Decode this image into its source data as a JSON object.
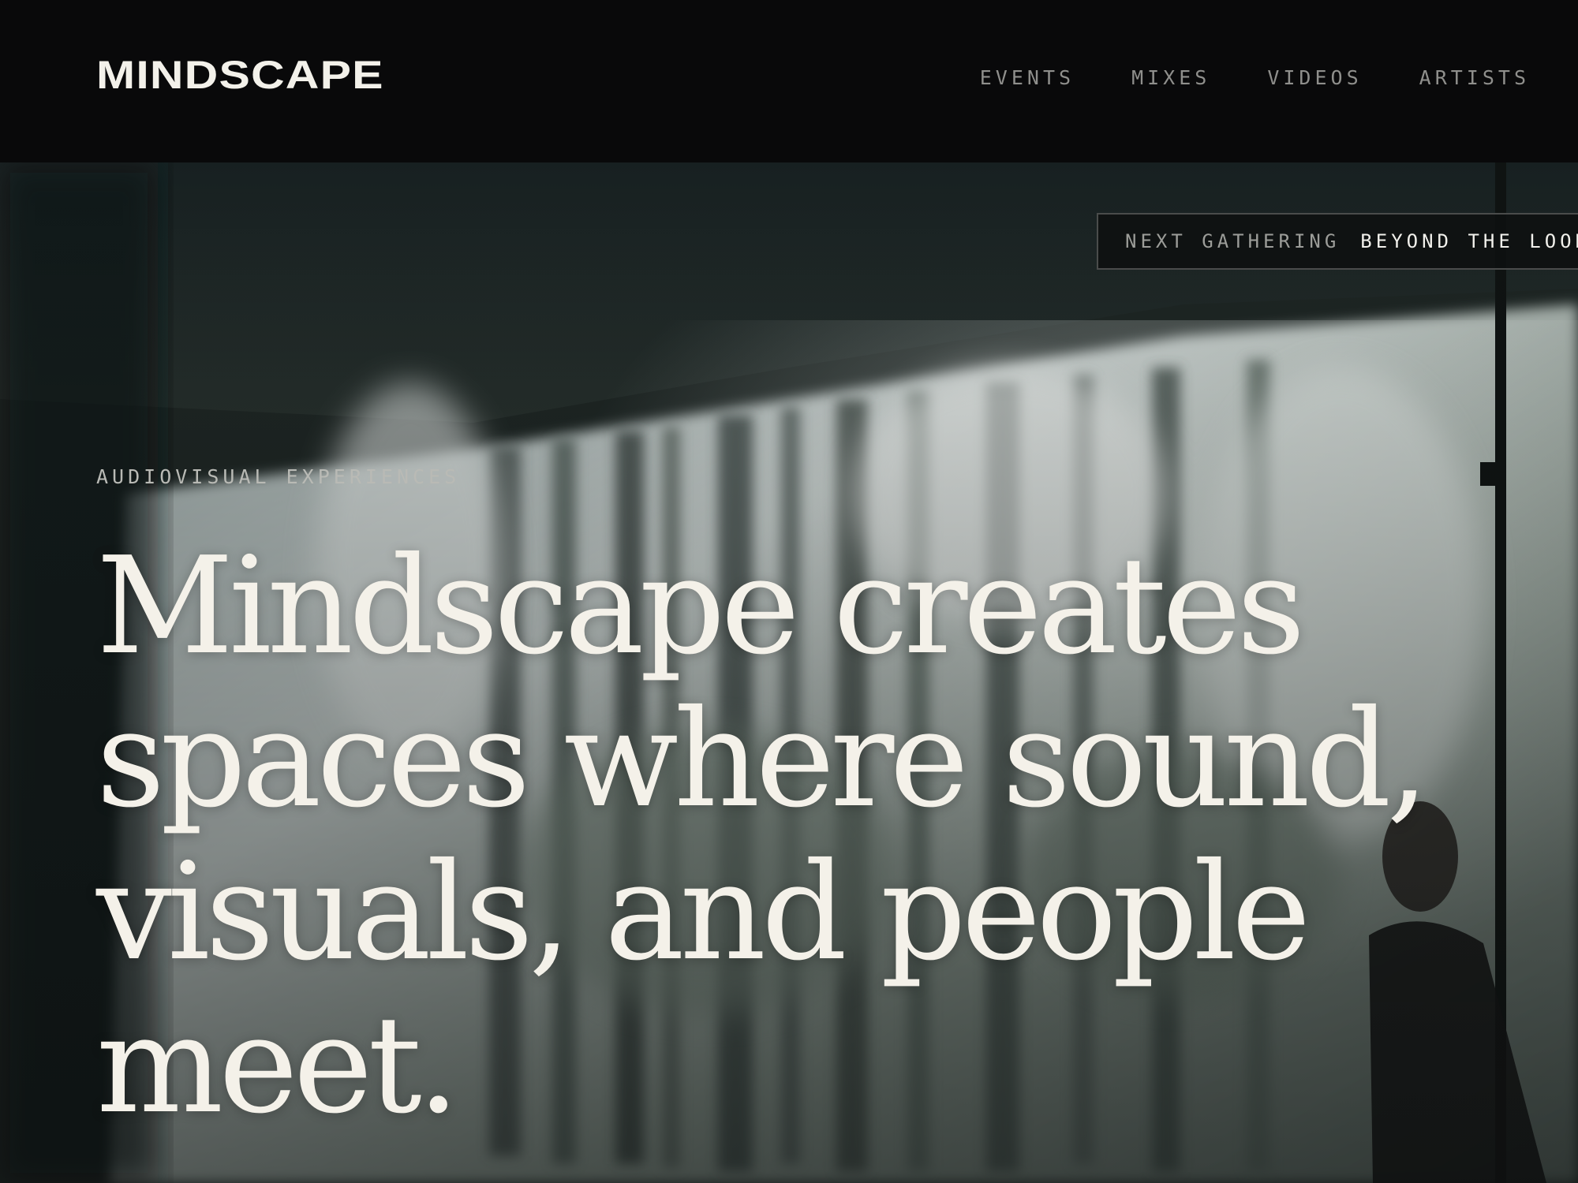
{
  "header": {
    "logo": "MINDSCAPE",
    "nav": [
      {
        "label": "EVENTS"
      },
      {
        "label": "MIXES"
      },
      {
        "label": "VIDEOS"
      },
      {
        "label": "ARTISTS"
      }
    ]
  },
  "ticker": {
    "label": "NEXT GATHERING",
    "title": "BEYOND THE LOOKIN"
  },
  "hero": {
    "eyebrow": "AUDIOVISUAL EXPERIENCES",
    "headline": "Mindscape creates spaces where sound, visuals, and people meet."
  },
  "colors": {
    "background": "#0a0a0b",
    "text_primary": "#f4f1e9",
    "text_muted": "#8f8f8c",
    "ticker_border": "#4a4c4b"
  }
}
